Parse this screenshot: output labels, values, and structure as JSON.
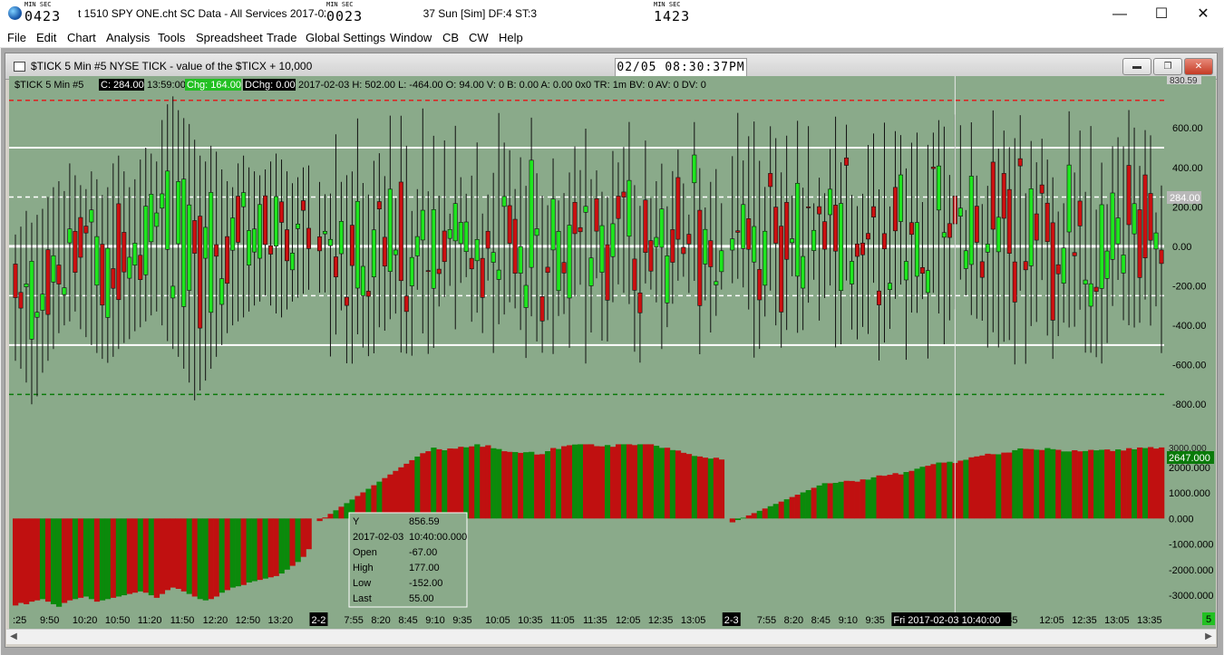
{
  "window": {
    "title": "Chart 1510 SPY ONE.cht  SC Data - All Services 2017-02-0",
    "title_tail": "37 Sun [Sim]  DF:4  ST:3",
    "clocks": [
      {
        "label": "MIN SEC",
        "value": "0423"
      },
      {
        "label": "MIN SEC",
        "value": "0023"
      },
      {
        "label": "MIN SEC",
        "value": "1423"
      }
    ],
    "minimize": "—",
    "maximize": "☐",
    "close": "✕"
  },
  "menu": [
    "File",
    "Edit",
    "Chart",
    "Analysis",
    "Tools",
    "Spreadsheet",
    "Trade",
    "Global Settings",
    "Window",
    "CB",
    "CW",
    "Help"
  ],
  "chart_window": {
    "title": "$TICK  5 Min  #5  NYSE TICK - value of the $TICX + 10,000",
    "system_clock": "02/05  08:30:37PM"
  },
  "chart_data": {
    "type": "candlestick",
    "symbol": "$TICK",
    "timeframe": "5 Min",
    "info_line": {
      "prefix": "$TICK  5 Min  #5",
      "close": "C: 284.00",
      "time": "13:59:00",
      "change": "Chg: 164.00",
      "dchange": "DChg: 0.00",
      "rest": "2017-02-03 H: 502.00  L: -464.00  O: 94.00  V: 0  B: 0.00  A: 0.00  0x0  TR: 1m  BV: 0  AV: 0  DV: 0"
    },
    "price_axis": {
      "min": -900,
      "max": 780,
      "ticks": [
        "600.00",
        "400.00",
        "200.00",
        "0.00",
        "-200.00",
        "-400.00",
        "-600.00",
        "-800.00"
      ]
    },
    "last_price_label": "284.00",
    "top_partial_label": "830.59",
    "reference_lines": [
      {
        "value": 740,
        "color": "#e02020",
        "style": "dashed"
      },
      {
        "value": 500,
        "color": "#ffffff",
        "style": "solid"
      },
      {
        "value": 250,
        "color": "#ffffff",
        "style": "dashed"
      },
      {
        "value": 0,
        "color": "#ffffff",
        "style": "thick"
      },
      {
        "value": -250,
        "color": "#ffffff",
        "style": "dashed"
      },
      {
        "value": -500,
        "color": "#ffffff",
        "style": "solid"
      },
      {
        "value": -750,
        "color": "#0a7a0a",
        "style": "dashed"
      }
    ],
    "cumulative_axis": {
      "min": -3600,
      "max": 2950,
      "ticks": [
        "2000.000",
        "1000.000",
        "0.000",
        "-1000.000",
        "-2000.000",
        "-3000.000"
      ]
    },
    "cumulative_last_label": "2647.000",
    "cumulative_top_label": "3000.000",
    "time_labels": [
      {
        "text": ":25",
        "slot": 0
      },
      {
        "text": "9:50",
        "slot": 5
      },
      {
        "text": "10:20",
        "slot": 11
      },
      {
        "text": "10:50",
        "slot": 17
      },
      {
        "text": "11:20",
        "slot": 23
      },
      {
        "text": "11:50",
        "slot": 29
      },
      {
        "text": "12:20",
        "slot": 35
      },
      {
        "text": "12:50",
        "slot": 41
      },
      {
        "text": "13:20",
        "slot": 47
      },
      {
        "text": "2-2",
        "slot": 55,
        "highlight": true
      },
      {
        "text": "7:55",
        "slot": 61
      },
      {
        "text": "8:20",
        "slot": 66
      },
      {
        "text": "8:45",
        "slot": 71
      },
      {
        "text": "9:10",
        "slot": 76
      },
      {
        "text": "9:35",
        "slot": 81
      },
      {
        "text": "10:05",
        "slot": 87
      },
      {
        "text": "10:35",
        "slot": 93
      },
      {
        "text": "11:05",
        "slot": 99
      },
      {
        "text": "11:35",
        "slot": 105
      },
      {
        "text": "12:05",
        "slot": 111
      },
      {
        "text": "12:35",
        "slot": 117
      },
      {
        "text": "13:05",
        "slot": 123
      },
      {
        "text": "2-3",
        "slot": 131,
        "highlight": true
      },
      {
        "text": "7:55",
        "slot": 137
      },
      {
        "text": "8:20",
        "slot": 142
      },
      {
        "text": "8:45",
        "slot": 147
      },
      {
        "text": "9:10",
        "slot": 152
      },
      {
        "text": "9:35",
        "slot": 157
      },
      {
        "text": "35",
        "slot": 183
      },
      {
        "text": "12:05",
        "slot": 189
      },
      {
        "text": "12:35",
        "slot": 195
      },
      {
        "text": "13:05",
        "slot": 201
      },
      {
        "text": "13:35",
        "slot": 207
      }
    ],
    "crosshair": {
      "slot": 173,
      "value": 856.59,
      "time_label": "Fri 2017-02-03  10:40:00"
    },
    "tooltip": [
      {
        "k": "Y",
        "v": "856.59"
      },
      {
        "k": "2017-02-03",
        "v": "10:40:00.000"
      },
      {
        "k": "Open",
        "v": "-67.00"
      },
      {
        "k": "High",
        "v": "177.00"
      },
      {
        "k": "Low",
        "v": "-152.00"
      },
      {
        "k": "Last",
        "v": "55.00"
      }
    ],
    "corner_label": "5",
    "bars": {
      "day1": {
        "slots": [
          0,
          55
        ]
      },
      "day2": {
        "slots": [
          56,
          131
        ]
      },
      "day3": {
        "slots": [
          132,
          211
        ]
      }
    },
    "price_highs": [
      60,
      100,
      180,
      120,
      160,
      190,
      250,
      300,
      330,
      280,
      420,
      360,
      310,
      290,
      380,
      340,
      260,
      300,
      420,
      460,
      380,
      300,
      340,
      440,
      500,
      470,
      430,
      640,
      720,
      760,
      690,
      650,
      620,
      540,
      460,
      430,
      510,
      480,
      390,
      330,
      300,
      420,
      460,
      400,
      380,
      360,
      390,
      430,
      470,
      440,
      380,
      320,
      350,
      400,
      410,
      360
    ],
    "price_lows": [
      -580,
      -620,
      -690,
      -800,
      -760,
      -640,
      -580,
      -520,
      -440,
      -400,
      -380,
      -330,
      -420,
      -460,
      -500,
      -540,
      -570,
      -590,
      -560,
      -520,
      -490,
      -470,
      -430,
      -410,
      -380,
      -350,
      -330,
      -400,
      -480,
      -520,
      -560,
      -620,
      -690,
      -780,
      -730,
      -680,
      -620,
      -560,
      -500,
      -440,
      -400,
      -380,
      -360,
      -330,
      -300,
      -280,
      -250,
      -300,
      -340,
      -360,
      -320,
      -280,
      -260,
      -240,
      -220,
      -200
    ],
    "cumulative": [
      -3400,
      -3300,
      -3350,
      -3250,
      -3200,
      -3150,
      -3250,
      -3350,
      -3450,
      -3300,
      -3200,
      -3150,
      -3100,
      -3050,
      -3150,
      -3250,
      -3200,
      -3150,
      -3100,
      -3050,
      -3000,
      -2950,
      -2900,
      -2850,
      -2900,
      -3000,
      -3100,
      -2950,
      -2800,
      -2700,
      -2750,
      -2850,
      -2950,
      -3050,
      -3150,
      -3200,
      -3150,
      -3050,
      -2900,
      -2800,
      -2700,
      -2650,
      -2600,
      -2500,
      -2450,
      -2400,
      -2350,
      -2300,
      -2250,
      -2150,
      -2000,
      -1850,
      -1700,
      -1500,
      -1200,
      -900
    ]
  }
}
